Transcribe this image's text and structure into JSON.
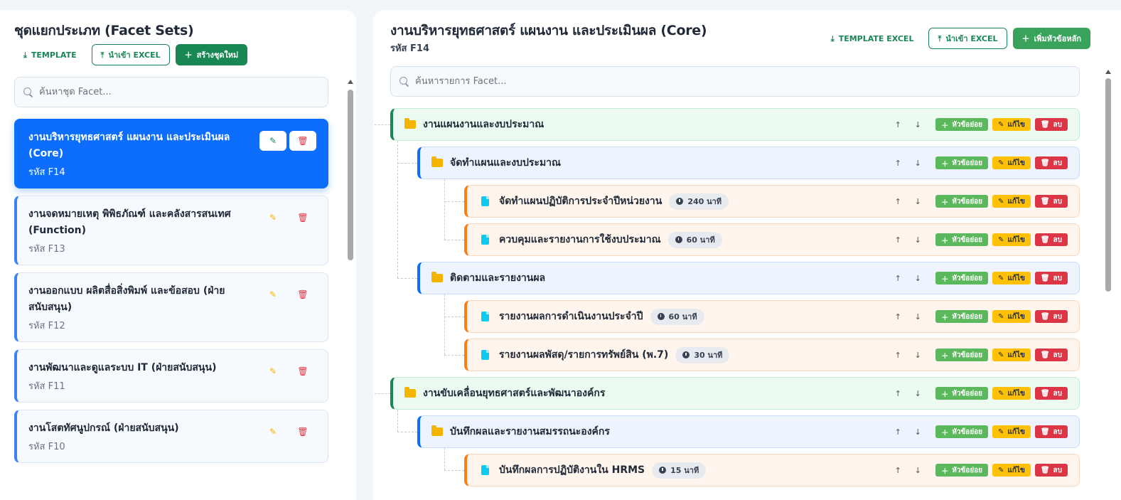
{
  "left": {
    "title": "ชุดแยกประเภท (Facet Sets)",
    "actions": {
      "template": "TEMPLATE",
      "import": "นำเข้า EXCEL",
      "create": "สร้างชุดใหม่"
    },
    "search_placeholder": "ค้นหาชุด Facet...",
    "facets": [
      {
        "name": "งานบริหารยุทธศาสตร์ แผนงาน และประเมินผล (Core)",
        "code": "รหัส F14",
        "active": true
      },
      {
        "name": "งานจดหมายเหตุ พิพิธภัณฑ์ และคลังสารสนเทศ (Function)",
        "code": "รหัส F13",
        "active": false
      },
      {
        "name": "งานออกแบบ ผลิตสื่อสิ่งพิมพ์ และข้อสอบ (ฝ่ายสนับสนุน)",
        "code": "รหัส F12",
        "active": false
      },
      {
        "name": "งานพัฒนาและดูแลระบบ IT (ฝ่ายสนับสนุน)",
        "code": "รหัส F11",
        "active": false
      },
      {
        "name": "งานโสตทัศนูปกรณ์ (ฝ่ายสนับสนุน)",
        "code": "รหัส F10",
        "active": false
      }
    ]
  },
  "right": {
    "title": "งานบริหารยุทธศาสตร์ แผนงาน และประเมินผล (Core)",
    "code": "รหัส F14",
    "actions": {
      "template": "TEMPLATE EXCEL",
      "import": "นำเข้า EXCEL",
      "add_main": "เพิ่มหัวข้อหลัก"
    },
    "search_placeholder": "ค้นหารายการ Facet...",
    "row_actions": {
      "up": "↑",
      "down": "↓",
      "add_sub": "หัวข้อย่อย",
      "edit": "แก้ไข",
      "delete": "ลบ"
    },
    "tree": [
      {
        "level": 0,
        "label": "งานแผนงานและงบประมาณ",
        "time": ""
      },
      {
        "level": 1,
        "label": "จัดทำแผนและงบประมาณ",
        "time": ""
      },
      {
        "level": 2,
        "label": "จัดทำแผนปฏิบัติการประจำปีหน่วยงาน",
        "time": "240 นาที"
      },
      {
        "level": 2,
        "label": "ควบคุมและรายงานการใช้งบประมาณ",
        "time": "60 นาที"
      },
      {
        "level": 1,
        "label": "ติดตามและรายงานผล",
        "time": ""
      },
      {
        "level": 2,
        "label": "รายงานผลการดำเนินงานประจำปี",
        "time": "60 นาที"
      },
      {
        "level": 2,
        "label": "รายงานผลพัสดุ/รายการทรัพย์สิน (พ.7)",
        "time": "30 นาที"
      },
      {
        "level": 0,
        "label": "งานขับเคลื่อนยุทธศาสตร์และพัฒนาองค์กร",
        "time": ""
      },
      {
        "level": 1,
        "label": "บันทึกผลและรายงานสมรรถนะองค์กร",
        "time": ""
      },
      {
        "level": 2,
        "label": "บันทึกผลการปฏิบัติงานใน HRMS",
        "time": "15 นาที"
      }
    ]
  },
  "colors": {
    "primary": "#0d6efd",
    "success": "#198754",
    "warning": "#ffc107",
    "danger": "#dc3545",
    "folder": "#f4b400",
    "file": "#0dcaf0"
  }
}
